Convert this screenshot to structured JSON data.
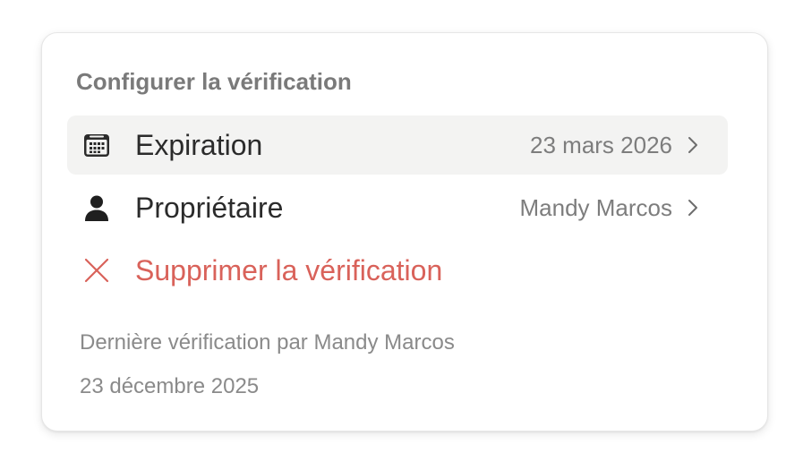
{
  "panel": {
    "title": "Configurer la vérification"
  },
  "rows": [
    {
      "icon": "calendar-icon",
      "label": "Expiration",
      "value": "23 mars 2026"
    },
    {
      "icon": "person-icon",
      "label": "Propriétaire",
      "value": "Mandy Marcos"
    },
    {
      "icon": "close-icon",
      "label": "Supprimer la vérification"
    }
  ],
  "footer": {
    "last_verified": "Dernière vérification par Mandy Marcos",
    "date": "23 décembre 2025"
  },
  "colors": {
    "danger": "#d9625a",
    "row_highlight": "#f3f3f2",
    "text_primary": "#2b2b2b",
    "text_secondary": "#7d7d7d"
  }
}
